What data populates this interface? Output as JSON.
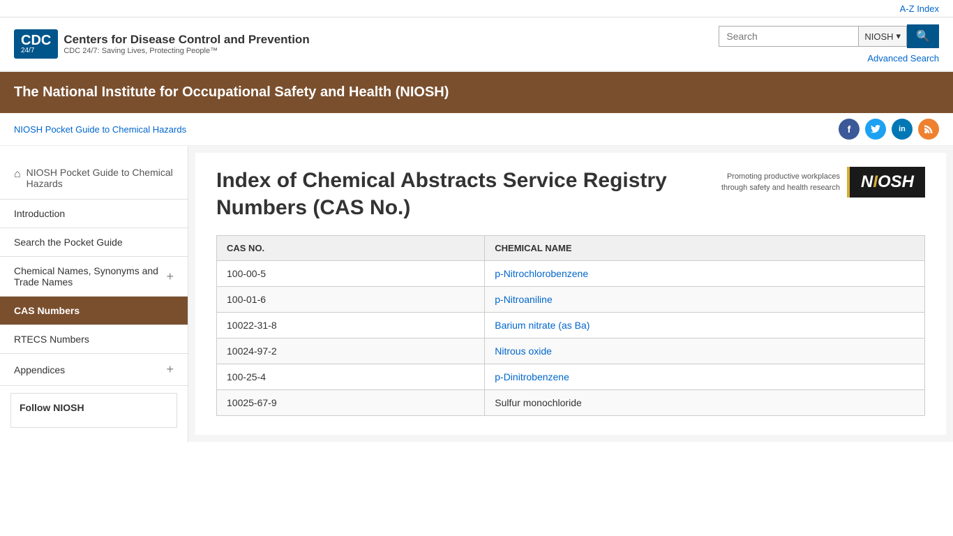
{
  "topBar": {
    "azIndex": "A-Z Index"
  },
  "header": {
    "logoText": "CDC",
    "logoSub": "24/7",
    "orgName": "Centers for Disease Control and Prevention",
    "tagline": "CDC 24/7: Saving Lives, Protecting People™",
    "search": {
      "placeholder": "Search",
      "scope": "NIOSH",
      "buttonIcon": "🔍"
    },
    "advancedSearch": "Advanced Search"
  },
  "nioshBanner": "The National Institute for Occupational Safety and Health (NIOSH)",
  "breadcrumb": "NIOSH Pocket Guide to Chemical Hazards",
  "social": {
    "fb": "f",
    "tw": "t",
    "li": "in",
    "rss": "r"
  },
  "sidebar": {
    "homeLabel": "NIOSH Pocket Guide to Chemical Hazards",
    "items": [
      {
        "id": "introduction",
        "label": "Introduction",
        "hasPlus": false
      },
      {
        "id": "search-pocket-guide",
        "label": "Search the Pocket Guide",
        "hasPlus": false
      },
      {
        "id": "chemical-names",
        "label": "Chemical Names, Synonyms and Trade Names",
        "hasPlus": true
      },
      {
        "id": "cas-numbers",
        "label": "CAS Numbers",
        "hasPlus": false,
        "active": true
      },
      {
        "id": "rtecs-numbers",
        "label": "RTECS Numbers",
        "hasPlus": false
      },
      {
        "id": "appendices",
        "label": "Appendices",
        "hasPlus": true
      }
    ],
    "followTitle": "Follow NIOSH"
  },
  "content": {
    "nioshLogoText1": "Promoting productive workplaces",
    "nioshLogoText2": "through safety and health research",
    "nioshBadge": "NIOSH",
    "pageTitle": "Index of Chemical Abstracts Service Registry Numbers (CAS No.)",
    "table": {
      "headers": [
        "CAS No.",
        "CHEMICAL NAME"
      ],
      "rows": [
        {
          "cas": "100-00-5",
          "name": "p-Nitrochlorobenzene",
          "link": true
        },
        {
          "cas": "100-01-6",
          "name": "p-Nitroaniline",
          "link": true
        },
        {
          "cas": "10022-31-8",
          "name": "Barium nitrate (as Ba)",
          "link": true
        },
        {
          "cas": "10024-97-2",
          "name": "Nitrous oxide",
          "link": true
        },
        {
          "cas": "100-25-4",
          "name": "p-Dinitrobenzene",
          "link": true
        },
        {
          "cas": "10025-67-9",
          "name": "Sulfur monochloride",
          "link": false
        }
      ]
    }
  }
}
